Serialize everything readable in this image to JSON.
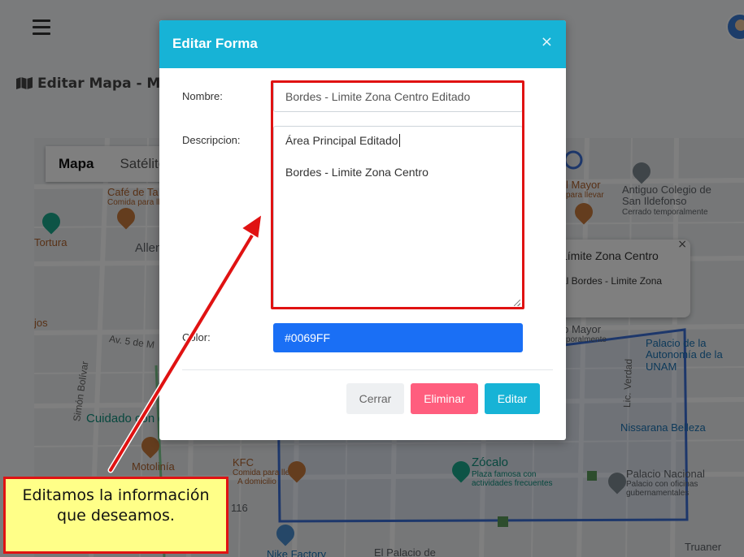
{
  "page": {
    "title": "Editar Mapa - Mapa",
    "menu_icon": "hamburger-menu-icon",
    "avatar_icon": "user-avatar-icon"
  },
  "map": {
    "map_type_buttons": [
      "Mapa",
      "Satélite"
    ],
    "pois": [
      {
        "name": "Café de Ta",
        "sub": "Comida para lle"
      },
      {
        "name": "Tortura",
        "sub": ""
      },
      {
        "name": "Allen",
        "sub": ""
      },
      {
        "name": "jos",
        "sub": ""
      },
      {
        "name": "Cuidado con el",
        "sub": ""
      },
      {
        "name": "Motolinía",
        "sub": ""
      },
      {
        "name": "KFC",
        "sub": "Comida para llevar"
      },
      {
        "name": "A domicilio",
        "sub": ""
      },
      {
        "name": "116",
        "sub": ""
      },
      {
        "name": "Nike Factory",
        "sub": ""
      },
      {
        "name": "El Palacio de",
        "sub": ""
      },
      {
        "name": "Zócalo",
        "sub": "Plaza famosa con actividades frecuentes"
      },
      {
        "name": "Palacio Nacional",
        "sub": "Palacio con oficinas gubernamentales"
      },
      {
        "name": "Nissarana Belleza",
        "sub": ""
      },
      {
        "name": "Palacio de la Autonomía de la UNAM",
        "sub": ""
      },
      {
        "name": "Antiguo Colegio de San Ildefonso",
        "sub": "Cerrado temporalmente"
      },
      {
        "name": "l Mayor",
        "sub": "para llevar"
      },
      {
        "name": "plo Mayor",
        "sub": "emporalmente"
      },
      {
        "name": "Truaner",
        "sub": ""
      }
    ],
    "streets": [
      "Av. 5 de M",
      "Simón Bolívar",
      "Lic. Verdad"
    ],
    "info_window": {
      "title": "Límite Zona Centro",
      "body": "al Bordes - Limite Zona",
      "close": "×"
    },
    "polygon_color": "#3b6fd6"
  },
  "modal": {
    "title": "Editar Forma",
    "close": "×",
    "nombre_label": "Nombre:",
    "nombre_value": "Bordes - Limite Zona Centro Editado",
    "descripcion_label": "Descripcion:",
    "descripcion_line1": "Área Principal Editado",
    "descripcion_line2": "Bordes - Limite Zona Centro",
    "color_label": "Color:",
    "color_value": "#0069FF",
    "buttons": {
      "cerrar": "Cerrar",
      "eliminar": "Eliminar",
      "editar": "Editar"
    },
    "header_color": "#17b3d6",
    "eliminar_color": "#ff5e7e",
    "color_swatch": "#1a6ff5"
  },
  "annotation": {
    "callout_text": "Editamos la información que deseamos.",
    "color": "#e01212",
    "callout_bg": "#ffff88"
  }
}
